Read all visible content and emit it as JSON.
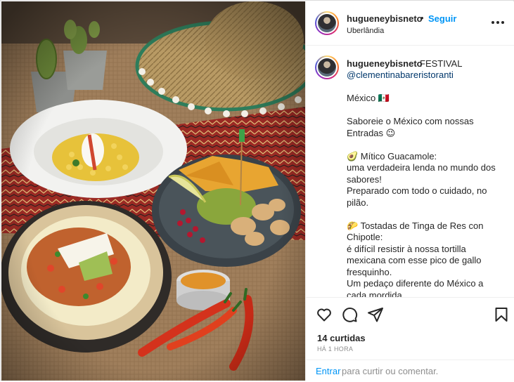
{
  "post": {
    "author": "hugueneybisneto",
    "separator": "•",
    "follow_label": "Seguir",
    "location": "Uberlândia",
    "caption_first_line": "FESTIVAL",
    "mention": "@clementinabareristoranti",
    "caption_lines": [
      "México 🇲🇽",
      "",
      "Saboreie o México com nossas",
      "Entradas 😉",
      "",
      "🥑 Mítico Guacamole:",
      "uma verdadeira lenda no mundo dos",
      "sabores!",
      "Preparado com todo o cuidado, no",
      "pilão.",
      "",
      "🌮 Tostadas de Tinga de Res con",
      "Chipotle:",
      "é difícil resistir à nossa tortilla",
      "mexicana com esse pico de gallo",
      "fresquinho.",
      "Um pedaço diferente do México a",
      "cada mordida."
    ],
    "likes_text": "14 curtidas",
    "time_text": "HÁ 1 HORA"
  },
  "comment_box": {
    "enter_label": "Entrar",
    "rest_text": "para curtir ou comentar."
  },
  "icons": {
    "more": "more-options-icon",
    "like": "heart-icon",
    "comment": "comment-icon",
    "share": "share-icon",
    "save": "bookmark-icon"
  },
  "colors": {
    "link_blue": "#0095f6",
    "mention_blue": "#00376b",
    "muted": "#8e8e8e",
    "text": "#262626"
  }
}
